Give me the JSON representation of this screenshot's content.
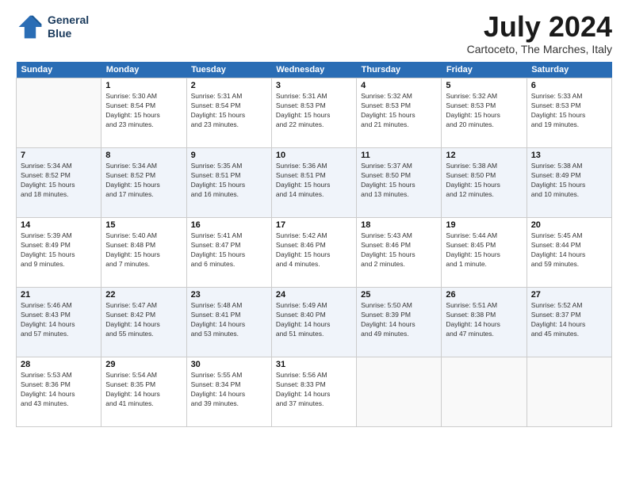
{
  "header": {
    "logo_line1": "General",
    "logo_line2": "Blue",
    "month": "July 2024",
    "location": "Cartoceto, The Marches, Italy"
  },
  "days_of_week": [
    "Sunday",
    "Monday",
    "Tuesday",
    "Wednesday",
    "Thursday",
    "Friday",
    "Saturday"
  ],
  "weeks": [
    [
      {
        "day": null,
        "info": null
      },
      {
        "day": "1",
        "info": "Sunrise: 5:30 AM\nSunset: 8:54 PM\nDaylight: 15 hours\nand 23 minutes."
      },
      {
        "day": "2",
        "info": "Sunrise: 5:31 AM\nSunset: 8:54 PM\nDaylight: 15 hours\nand 23 minutes."
      },
      {
        "day": "3",
        "info": "Sunrise: 5:31 AM\nSunset: 8:53 PM\nDaylight: 15 hours\nand 22 minutes."
      },
      {
        "day": "4",
        "info": "Sunrise: 5:32 AM\nSunset: 8:53 PM\nDaylight: 15 hours\nand 21 minutes."
      },
      {
        "day": "5",
        "info": "Sunrise: 5:32 AM\nSunset: 8:53 PM\nDaylight: 15 hours\nand 20 minutes."
      },
      {
        "day": "6",
        "info": "Sunrise: 5:33 AM\nSunset: 8:53 PM\nDaylight: 15 hours\nand 19 minutes."
      }
    ],
    [
      {
        "day": "7",
        "info": "Sunrise: 5:34 AM\nSunset: 8:52 PM\nDaylight: 15 hours\nand 18 minutes."
      },
      {
        "day": "8",
        "info": "Sunrise: 5:34 AM\nSunset: 8:52 PM\nDaylight: 15 hours\nand 17 minutes."
      },
      {
        "day": "9",
        "info": "Sunrise: 5:35 AM\nSunset: 8:51 PM\nDaylight: 15 hours\nand 16 minutes."
      },
      {
        "day": "10",
        "info": "Sunrise: 5:36 AM\nSunset: 8:51 PM\nDaylight: 15 hours\nand 14 minutes."
      },
      {
        "day": "11",
        "info": "Sunrise: 5:37 AM\nSunset: 8:50 PM\nDaylight: 15 hours\nand 13 minutes."
      },
      {
        "day": "12",
        "info": "Sunrise: 5:38 AM\nSunset: 8:50 PM\nDaylight: 15 hours\nand 12 minutes."
      },
      {
        "day": "13",
        "info": "Sunrise: 5:38 AM\nSunset: 8:49 PM\nDaylight: 15 hours\nand 10 minutes."
      }
    ],
    [
      {
        "day": "14",
        "info": "Sunrise: 5:39 AM\nSunset: 8:49 PM\nDaylight: 15 hours\nand 9 minutes."
      },
      {
        "day": "15",
        "info": "Sunrise: 5:40 AM\nSunset: 8:48 PM\nDaylight: 15 hours\nand 7 minutes."
      },
      {
        "day": "16",
        "info": "Sunrise: 5:41 AM\nSunset: 8:47 PM\nDaylight: 15 hours\nand 6 minutes."
      },
      {
        "day": "17",
        "info": "Sunrise: 5:42 AM\nSunset: 8:46 PM\nDaylight: 15 hours\nand 4 minutes."
      },
      {
        "day": "18",
        "info": "Sunrise: 5:43 AM\nSunset: 8:46 PM\nDaylight: 15 hours\nand 2 minutes."
      },
      {
        "day": "19",
        "info": "Sunrise: 5:44 AM\nSunset: 8:45 PM\nDaylight: 15 hours\nand 1 minute."
      },
      {
        "day": "20",
        "info": "Sunrise: 5:45 AM\nSunset: 8:44 PM\nDaylight: 14 hours\nand 59 minutes."
      }
    ],
    [
      {
        "day": "21",
        "info": "Sunrise: 5:46 AM\nSunset: 8:43 PM\nDaylight: 14 hours\nand 57 minutes."
      },
      {
        "day": "22",
        "info": "Sunrise: 5:47 AM\nSunset: 8:42 PM\nDaylight: 14 hours\nand 55 minutes."
      },
      {
        "day": "23",
        "info": "Sunrise: 5:48 AM\nSunset: 8:41 PM\nDaylight: 14 hours\nand 53 minutes."
      },
      {
        "day": "24",
        "info": "Sunrise: 5:49 AM\nSunset: 8:40 PM\nDaylight: 14 hours\nand 51 minutes."
      },
      {
        "day": "25",
        "info": "Sunrise: 5:50 AM\nSunset: 8:39 PM\nDaylight: 14 hours\nand 49 minutes."
      },
      {
        "day": "26",
        "info": "Sunrise: 5:51 AM\nSunset: 8:38 PM\nDaylight: 14 hours\nand 47 minutes."
      },
      {
        "day": "27",
        "info": "Sunrise: 5:52 AM\nSunset: 8:37 PM\nDaylight: 14 hours\nand 45 minutes."
      }
    ],
    [
      {
        "day": "28",
        "info": "Sunrise: 5:53 AM\nSunset: 8:36 PM\nDaylight: 14 hours\nand 43 minutes."
      },
      {
        "day": "29",
        "info": "Sunrise: 5:54 AM\nSunset: 8:35 PM\nDaylight: 14 hours\nand 41 minutes."
      },
      {
        "day": "30",
        "info": "Sunrise: 5:55 AM\nSunset: 8:34 PM\nDaylight: 14 hours\nand 39 minutes."
      },
      {
        "day": "31",
        "info": "Sunrise: 5:56 AM\nSunset: 8:33 PM\nDaylight: 14 hours\nand 37 minutes."
      },
      {
        "day": null,
        "info": null
      },
      {
        "day": null,
        "info": null
      },
      {
        "day": null,
        "info": null
      }
    ]
  ]
}
